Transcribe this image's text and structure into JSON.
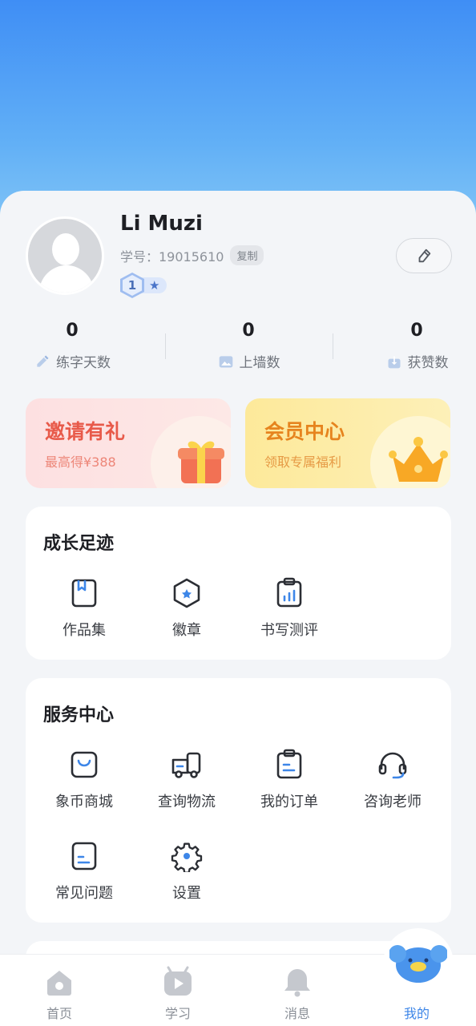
{
  "profile": {
    "name": "Li Muzi",
    "id_label": "学号：19015610",
    "copy_label": "复制",
    "level": "1"
  },
  "stats": [
    {
      "value": "0",
      "label": "练字天数",
      "icon": "pencil-icon"
    },
    {
      "value": "0",
      "label": "上墙数",
      "icon": "picture-wall-icon"
    },
    {
      "value": "0",
      "label": "获赞数",
      "icon": "like-icon"
    }
  ],
  "promos": {
    "invite": {
      "title": "邀请有礼",
      "subtitle": "最高得¥388",
      "icon": "gift-icon"
    },
    "vip": {
      "title": "会员中心",
      "subtitle": "领取专属福利",
      "icon": "crown-icon"
    }
  },
  "growth": {
    "title": "成长足迹",
    "items": [
      {
        "label": "作品集",
        "icon": "bookmark-book-icon"
      },
      {
        "label": "徽章",
        "icon": "badge-icon"
      },
      {
        "label": "书写测评",
        "icon": "clipboard-chart-icon"
      }
    ]
  },
  "service": {
    "title": "服务中心",
    "items": [
      {
        "label": "象币商城",
        "icon": "shopping-bag-icon"
      },
      {
        "label": "查询物流",
        "icon": "truck-icon"
      },
      {
        "label": "我的订单",
        "icon": "order-clipboard-icon"
      },
      {
        "label": "咨询老师",
        "icon": "headset-icon"
      },
      {
        "label": "常见问题",
        "icon": "faq-doc-icon"
      },
      {
        "label": "设置",
        "icon": "gear-icon"
      }
    ]
  },
  "tabbar": {
    "items": [
      {
        "label": "首页",
        "icon": "home-icon"
      },
      {
        "label": "学习",
        "icon": "play-icon"
      },
      {
        "label": "消息",
        "icon": "bell-icon"
      },
      {
        "label": "我的",
        "icon": "mascot-icon"
      }
    ],
    "active": "我的"
  },
  "colors": {
    "accent": "#3d86e8",
    "header_gradient_top": "#3f8ef5",
    "invite_red": "#e85a4a",
    "vip_orange": "#e6841e"
  }
}
